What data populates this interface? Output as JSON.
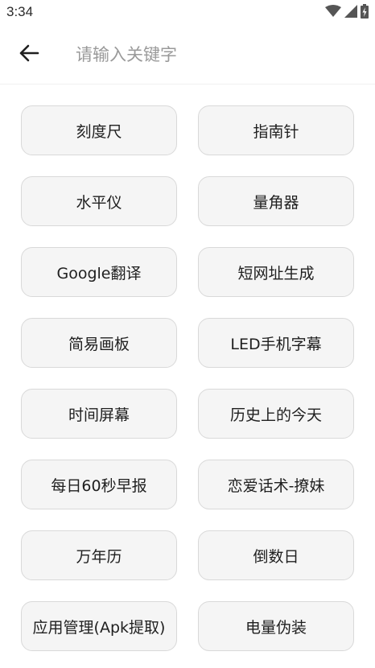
{
  "status_bar": {
    "time": "3:34",
    "icons": [
      "wifi-icon",
      "cellular-signal-icon",
      "battery-icon"
    ]
  },
  "search": {
    "placeholder": "请输入关键字",
    "value": ""
  },
  "tools": [
    "刻度尺",
    "指南针",
    "水平仪",
    "量角器",
    "Google翻译",
    "短网址生成",
    "简易画板",
    "LED手机字幕",
    "时间屏幕",
    "历史上的今天",
    "每日60秒早报",
    "恋爱话术-撩妹",
    "万年历",
    "倒数日",
    "应用管理(Apk提取)",
    "电量伪装"
  ],
  "colors": {
    "background": "#ffffff",
    "button_bg": "#f5f5f5",
    "button_border": "#d9d9d9",
    "text": "#202020",
    "placeholder": "#9a9a9a"
  }
}
